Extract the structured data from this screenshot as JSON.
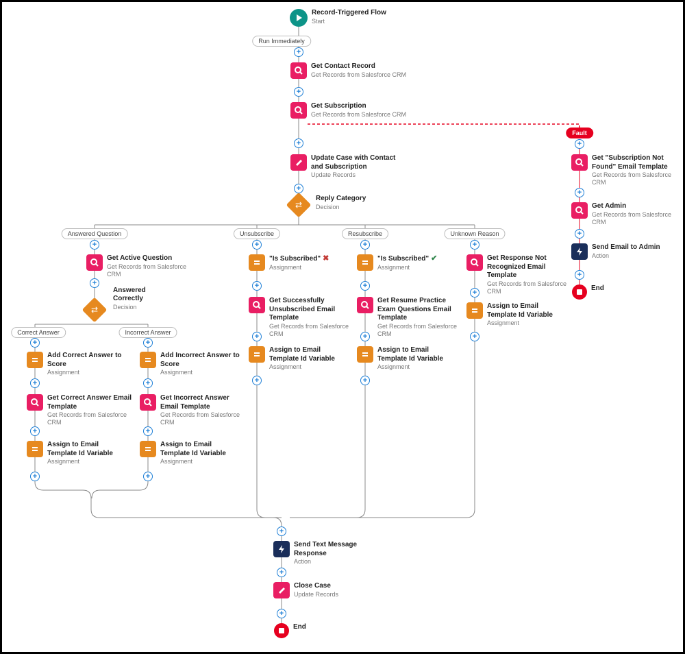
{
  "start": {
    "title": "Record-Triggered Flow",
    "sub": "Start"
  },
  "labels": {
    "run_immediately": "Run Immediately",
    "answered_question": "Answered Question",
    "unsubscribe": "Unsubscribe",
    "resubscribe": "Resubscribe",
    "unknown_reason": "Unknown Reason",
    "correct_answer": "Correct Answer",
    "incorrect_answer": "Incorrect Answer",
    "fault": "Fault"
  },
  "nodes": {
    "get_contact": {
      "title": "Get Contact Record",
      "sub": "Get Records from Salesforce CRM"
    },
    "get_subscription": {
      "title": "Get Subscription",
      "sub": "Get Records from Salesforce CRM"
    },
    "update_case": {
      "title": "Update Case with Contact and Subscription",
      "sub": "Update Records"
    },
    "reply_category": {
      "title": "Reply Category",
      "sub": "Decision"
    },
    "get_active_q": {
      "title": "Get Active Question",
      "sub": "Get Records from Salesforce CRM"
    },
    "answered_correctly": {
      "title": "Answered Correctly",
      "sub": "Decision"
    },
    "add_correct": {
      "title": "Add Correct Answer to Score",
      "sub": "Assignment"
    },
    "get_correct_tmpl": {
      "title": "Get Correct Answer Email Template",
      "sub": "Get Records from Salesforce CRM"
    },
    "assign_tmpl1": {
      "title": "Assign to Email Template Id Variable",
      "sub": "Assignment"
    },
    "add_incorrect": {
      "title": "Add Incorrect Answer to Score",
      "sub": "Assignment"
    },
    "get_incorrect_tmpl": {
      "title": "Get Incorrect Answer Email Template",
      "sub": "Get Records from Salesforce CRM"
    },
    "assign_tmpl2": {
      "title": "Assign to Email Template Id Variable",
      "sub": "Assignment"
    },
    "is_sub_false": {
      "title": "\"Is Subscribed\"",
      "sub": "Assignment",
      "mark": "cross"
    },
    "get_unsub_tmpl": {
      "title": "Get Successfully Unsubscribed Email Template",
      "sub": "Get Records from Salesforce CRM"
    },
    "assign_tmpl3": {
      "title": "Assign to Email Template Id Variable",
      "sub": "Assignment"
    },
    "is_sub_true": {
      "title": "\"Is Subscribed\"",
      "sub": "Assignment",
      "mark": "check"
    },
    "get_resume_tmpl": {
      "title": "Get Resume Practice Exam Questions Email Template",
      "sub": "Get Records from Salesforce CRM"
    },
    "assign_tmpl4": {
      "title": "Assign to Email Template Id Variable",
      "sub": "Assignment"
    },
    "get_unrecog_tmpl": {
      "title": "Get Response Not Recognized Email Template",
      "sub": "Get Records from Salesforce CRM"
    },
    "assign_tmpl5": {
      "title": "Assign to Email Template Id Variable",
      "sub": "Assignment"
    },
    "send_text": {
      "title": "Send Text Message Response",
      "sub": "Action"
    },
    "close_case": {
      "title": "Close Case",
      "sub": "Update Records"
    },
    "end1": {
      "title": "End"
    },
    "get_sub_nf": {
      "title": "Get \"Subscription Not Found\" Email Template",
      "sub": "Get Records from Salesforce CRM"
    },
    "get_admin": {
      "title": "Get Admin",
      "sub": "Get Records from Salesforce CRM"
    },
    "send_admin": {
      "title": "Send Email to Admin",
      "sub": "Action"
    },
    "end2": {
      "title": "End"
    }
  }
}
